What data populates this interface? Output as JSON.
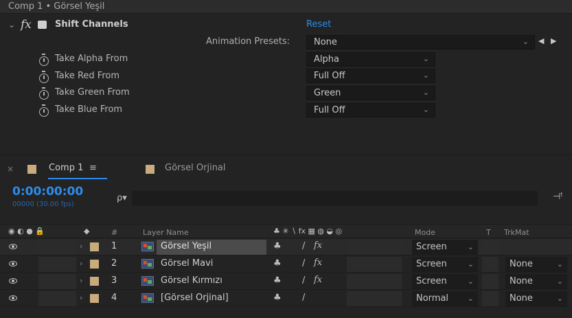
{
  "effect_controls": {
    "title": "Comp 1 • Görsel Yeşil",
    "fx_symbol": "fx",
    "effect_name": "Shift Channels",
    "reset_label": "Reset",
    "animation_presets_label": "Animation Presets:",
    "animation_presets_value": "None",
    "properties": [
      {
        "label": "Take Alpha From",
        "value": "Alpha"
      },
      {
        "label": "Take Red From",
        "value": "Full Off"
      },
      {
        "label": "Take Green From",
        "value": "Green"
      },
      {
        "label": "Take Blue From",
        "value": "Full Off"
      }
    ]
  },
  "timeline": {
    "tabs": [
      {
        "label": "Comp 1",
        "active": true
      },
      {
        "label": "Görsel Orjinal",
        "active": false
      }
    ],
    "menu_icon": "≡",
    "close_icon": "×",
    "timecode": "0:00:00:00",
    "frame_info": "00000 (30.00 fps)",
    "search_icon": "ρ▾",
    "columns": {
      "hash": "#",
      "layer_name": "Layer Name",
      "mode": "Mode",
      "t": "T",
      "trkmat": "TrkMat"
    },
    "layers": [
      {
        "num": "1",
        "name": "Görsel Yeşil",
        "mode": "Screen",
        "trkmat": "",
        "has_fx": true,
        "selected": true
      },
      {
        "num": "2",
        "name": "Görsel Mavi",
        "mode": "Screen",
        "trkmat": "None",
        "has_fx": true,
        "selected": false
      },
      {
        "num": "3",
        "name": "Görsel Kırmızı",
        "mode": "Screen",
        "trkmat": "None",
        "has_fx": true,
        "selected": false
      },
      {
        "num": "4",
        "name": "[Görsel Orjinal]",
        "mode": "Normal",
        "trkmat": "None",
        "has_fx": false,
        "selected": false
      }
    ],
    "accent_color": "#2d8ceb",
    "label_color": "#c9ab7d"
  }
}
